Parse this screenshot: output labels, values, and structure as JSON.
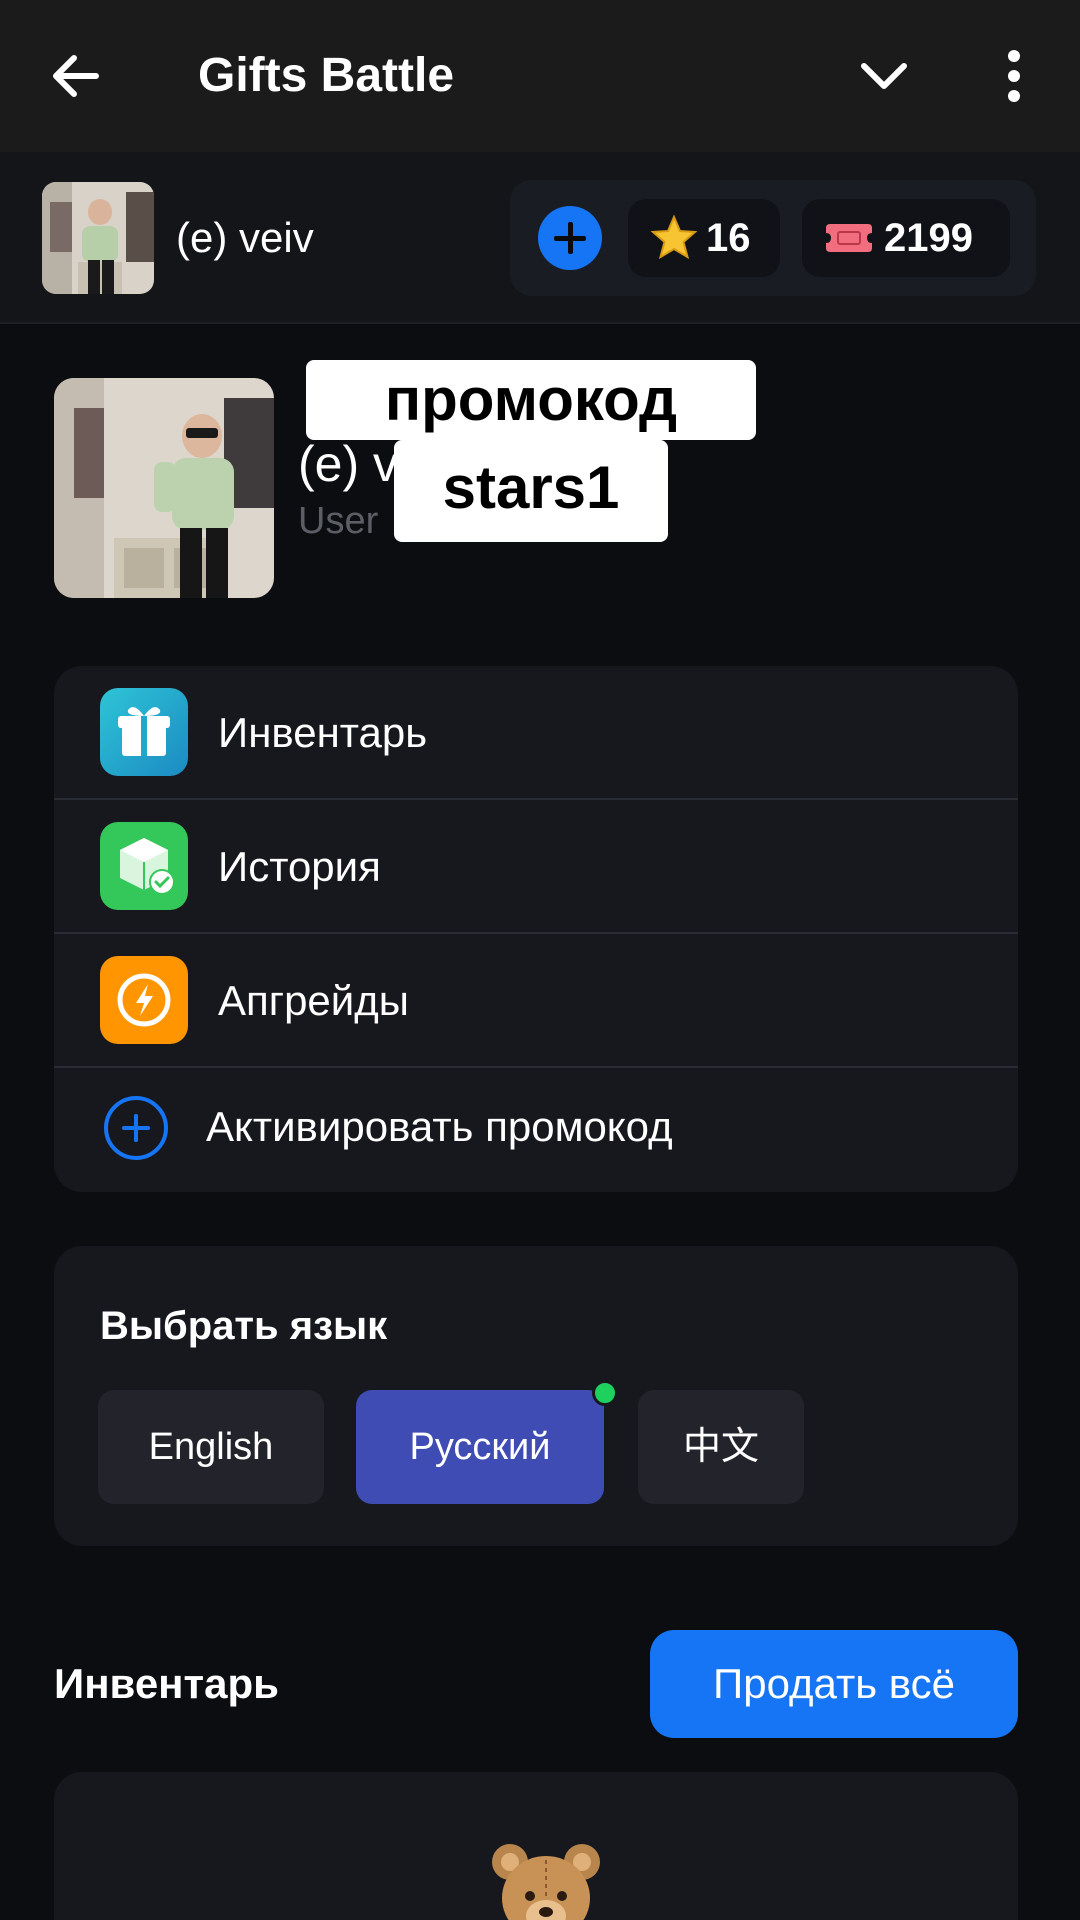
{
  "appbar": {
    "title": "Gifts Battle",
    "back_icon": "arrow-left-icon",
    "dropdown_icon": "chevron-down-icon",
    "more_icon": "more-vertical-icon"
  },
  "user": {
    "name": "(e) veiv",
    "stars": "16",
    "tickets": "2199"
  },
  "profile": {
    "name": "(e) v",
    "subtitle": "User"
  },
  "overlay": {
    "line1": "промокод",
    "line2": "stars1"
  },
  "menu": {
    "items": [
      {
        "label": "Инвентарь",
        "icon": "gift-icon",
        "color": "#1fa8c8"
      },
      {
        "label": "История",
        "icon": "box-check-icon",
        "color": "#34c759"
      },
      {
        "label": "Апгрейды",
        "icon": "lightning-icon",
        "color": "#ff9500"
      },
      {
        "label": "Активировать промокод",
        "icon": "plus-circle-icon",
        "color": "#1575f5"
      }
    ]
  },
  "language": {
    "title": "Выбрать язык",
    "options": [
      "English",
      "Русский",
      "中文"
    ],
    "selected": "Русский"
  },
  "inventory": {
    "title": "Инвентарь",
    "sell_all": "Продать всё",
    "first_item_icon": "teddy-bear-icon"
  },
  "colors": {
    "accent": "#1575f5",
    "selected_language": "#3e4cb4",
    "online_dot": "#1ed05d",
    "background": "#0c0d11",
    "card": "#17181e"
  }
}
